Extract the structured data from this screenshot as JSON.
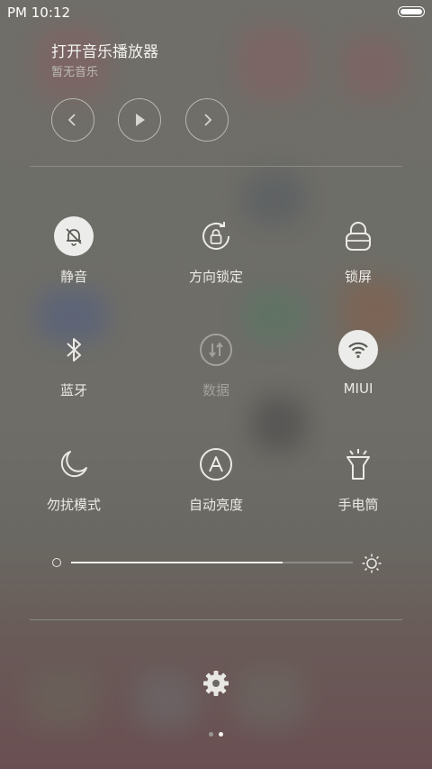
{
  "status_bar": {
    "time": "PM 10:12"
  },
  "music": {
    "title": "打开音乐播放器",
    "subtitle": "暂无音乐",
    "controls": [
      "previous",
      "play",
      "next"
    ]
  },
  "toggles": [
    {
      "label": "静音",
      "icon": "bell-off-icon",
      "active": true
    },
    {
      "label": "方向锁定",
      "icon": "rotation-lock-icon",
      "active": false
    },
    {
      "label": "锁屏",
      "icon": "lock-icon",
      "active": false
    },
    {
      "label": "蓝牙",
      "icon": "bluetooth-icon",
      "active": false
    },
    {
      "label": "数据",
      "icon": "mobile-data-icon",
      "active": false,
      "disabled": true
    },
    {
      "label": "MIUI",
      "icon": "wifi-icon",
      "active": true
    },
    {
      "label": "勿扰模式",
      "icon": "moon-icon",
      "active": false
    },
    {
      "label": "自动亮度",
      "icon": "auto-brightness-icon",
      "active": false
    },
    {
      "label": "手电筒",
      "icon": "flashlight-icon",
      "active": false
    }
  ],
  "brightness": {
    "level_fraction": 0.75
  },
  "pager": {
    "pages": 2,
    "current": 2
  },
  "colors": {
    "active_fill": "#ececea",
    "icon_stroke": "#eceae6",
    "disabled": "#a3a29c"
  }
}
